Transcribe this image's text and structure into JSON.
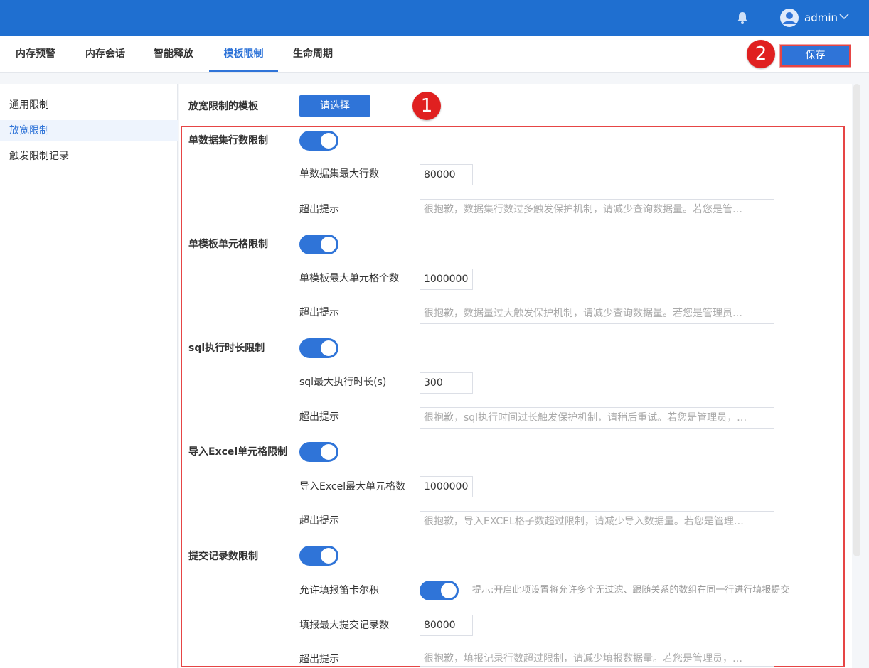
{
  "header": {
    "username": "admin",
    "bell_icon": "bell-icon",
    "avatar_icon": "user-icon",
    "dropdown_icon": "chevron-down-icon"
  },
  "tabs": [
    "内存预警",
    "内存会话",
    "智能释放",
    "模板限制",
    "生命周期"
  ],
  "active_tab": "模板限制",
  "save_label": "保存",
  "markers": [
    "1",
    "2"
  ],
  "sidebar": {
    "items": [
      "通用限制",
      "放宽限制",
      "触发限制记录"
    ],
    "active": "放宽限制"
  },
  "relax_template": {
    "label": "放宽限制的模板",
    "button": "请选择"
  },
  "sections": {
    "dataset": {
      "title": "单数据集行数限制",
      "enabled": true,
      "max_label": "单数据集最大行数",
      "max_value": "80000",
      "tip_label": "超出提示",
      "tip_value": "很抱歉，数据集行数过多触发保护机制，请减少查询数据量。若您是管…"
    },
    "cells": {
      "title": "单模板单元格限制",
      "enabled": true,
      "max_label": "单模板最大单元格个数",
      "max_value": "1000000",
      "tip_label": "超出提示",
      "tip_value": "很抱歉，数据量过大触发保护机制，请减少查询数据量。若您是管理员…"
    },
    "sql": {
      "title": "sql执行时长限制",
      "enabled": true,
      "max_label": "sql最大执行时长(s)",
      "max_value": "300",
      "tip_label": "超出提示",
      "tip_value": "很抱歉，sql执行时间过长触发保护机制，请稍后重试。若您是管理员，…"
    },
    "excel": {
      "title": "导入Excel单元格限制",
      "enabled": true,
      "max_label": "导入Excel最大单元格数",
      "max_value": "1000000",
      "tip_label": "超出提示",
      "tip_value": "很抱歉，导入EXCEL格子数超过限制，请减少导入数据量。若您是管理…"
    },
    "submit": {
      "title": "提交记录数限制",
      "enabled": true,
      "cartesian_label": "允许填报笛卡尔积",
      "cartesian_enabled": true,
      "cartesian_hint": "提示:开启此项设置将允许多个无过滤、跟随关系的数组在同一行进行填报提交",
      "max_label": "填报最大提交记录数",
      "max_value": "80000",
      "tip_label": "超出提示",
      "tip_value": "很抱歉，填报记录行数超过限制，请减少填报数据量。若您是管理员，…"
    }
  }
}
